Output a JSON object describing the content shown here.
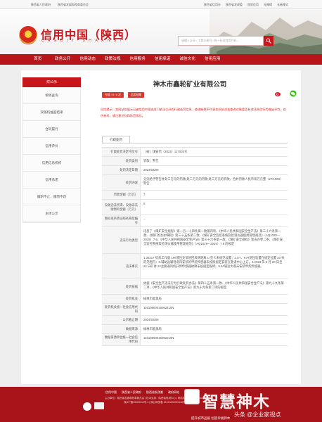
{
  "topbar": {
    "left": [
      "陕西省人民政府",
      "陕西省发展和改革委员会"
    ],
    "right": [
      "陕西省信用办",
      "陕西省发改委",
      "国家信用",
      "无障碍",
      "长者模式"
    ]
  },
  "header": {
    "logo_cn": "信用中国（陕西）",
    "logo_en": "CREDIT SHAANXI",
    "search_placeholder": "请输入企业 / 工商注册号 / 统一社会信用代码..."
  },
  "nav": [
    "首页",
    "政务公开",
    "信用动态",
    "政策法规",
    "信用服务",
    "信用承诺",
    "诚信文化",
    "信用应用"
  ],
  "sidebar": {
    "head": "双公示",
    "items": [
      "黎佩查询",
      "双随机抽查结果",
      "合同履行",
      "信用评价",
      "信用信息机构",
      "信用承诺",
      "履职不止，遵而不改",
      "主体公示"
    ]
  },
  "company": {
    "name": "神木市鑫轮矿业有限公司",
    "tags": [
      "行政 / 6 / 6 次",
      "信用档案"
    ],
    "risk": "风险提示：本网站仅展示已被信用中国或部门依法公开的行政处罚信息，查询结果不代表本网站对该查询对象是否有违法失信行为做出评判，仅供参考，请注意识别和防范风险。"
  },
  "tab_label": "行政处罚",
  "table": [
    {
      "k": "行政处罚决定书文号",
      "v": "（榆）煤安罚（2023）117003号"
    },
    {
      "k": "处罚类别",
      "v": "罚款；警告"
    },
    {
      "k": "处罚决定日期",
      "v": "2023/03/09"
    },
    {
      "k": "处罚内容",
      "v": "分别给予警告并处三万元的罚款;处二万元的罚款;处三万元的罚款，合并罚款人民币柒万元整（¥70,000）警告"
    },
    {
      "k": "罚款金额（万元）",
      "v": "7"
    },
    {
      "k": "没收违法所得、没收非法财物的金额（万元）",
      "v": "0"
    },
    {
      "k": "暂扣或吊销证照名称及编号",
      "v": "--"
    },
    {
      "k": "违法行为类型",
      "v": "违反了《煤矿安全规程》第一百一十四条第一款第四项、《中华人民共和国安全生产法》第三十六条第一款、《煤矿防治水细则》第三十五条第二款、《煤矿安全监控系统及检测仪器使用管理规范》（AQ1029—2019）7.6、《中华人民共和国安全生产法》第三十六条第一款、《煤矿安全规程》第五百零二条、《煤矿安全监控系统及检测仪器使用管理规范》（AQ1029—2019）7.9 的规定"
    },
    {
      "k": "违法事实",
      "v": "1.32217 综采工作面 19#液压支架进回风侧距离 U 型卡未规范设置；2.ST、K7#测压装置在规定位置 20 米的范围内；3.辅助运输巷道内安装的甲烷传感器未按照规定安装在巷道中心上方。4.2023 年 2 月 20 日至 22 日矿井 2#主要通风机开停传感器故障未按规定报修。5.5#辅运大巷未安装甲烷传感器。"
    },
    {
      "k": "处罚依据",
      "v": "依据《安全生产违法行为行政处罚办法》第四十五条第一款、《中华人民共和国安全生产法》第九十九条第二项、《中华人民共和国安全生产法》第九十九条第二项的规定"
    },
    {
      "k": "处罚机关",
      "v": "榆林市能源局"
    },
    {
      "k": "处罚机关统一社会信用代码",
      "v": "11610800016082210N"
    },
    {
      "k": "公示截止期",
      "v": "2024/03/09"
    },
    {
      "k": "数据来源",
      "v": "榆林市能源局"
    },
    {
      "k": "数据来源单位统一社会信用代码",
      "v": "11610800016082210N"
    }
  ],
  "footer": {
    "links": [
      "信用中国",
      "陕西省人民政府",
      "陕西省发改委",
      "政府网站"
    ],
    "line1": "主办单位：陕西省发展和改革委员会 | 技术支持：陕西省信用中心 | 网站标识码 6100000028",
    "line2": "陕ICP备05005319号-1 | 陕公网安备 61010402000146号",
    "watermark_big": "智慧神木",
    "watermark_small": "头条 @企业家视点",
    "watermark_bottom": "提升城市品质 创造幸福神木"
  },
  "colors": {
    "brand_red": "#c8161d",
    "nav_red": "#b8151b",
    "footer_red": "#a8141a"
  }
}
